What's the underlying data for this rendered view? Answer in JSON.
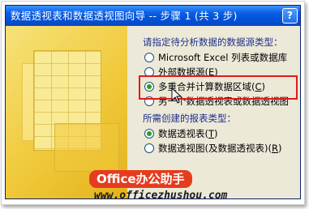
{
  "dialog": {
    "title": "数据透视表和数据透视图向导 -- 步骤 1 (共 3 步)",
    "help_label": "?"
  },
  "source_group": {
    "label": "请指定待分析数据的数据源类型：",
    "options": [
      {
        "pre": "Microsoft Excel 列表或数据库",
        "key": "",
        "post": "",
        "checked": false
      },
      {
        "pre": "外部数据源(",
        "key": "E",
        "post": ")",
        "checked": false
      },
      {
        "pre": "多重合并计算数据区域(",
        "key": "C",
        "post": ")",
        "checked": true
      },
      {
        "pre": "另一个数据透视表或数据透视图",
        "key": "",
        "post": "",
        "checked": false
      }
    ]
  },
  "report_group": {
    "label": "所需创建的报表类型：",
    "options": [
      {
        "pre": "数据透视表(",
        "key": "T",
        "post": ")",
        "checked": true
      },
      {
        "pre": "数据透视图(及数据透视表)(",
        "key": "R",
        "post": ")",
        "checked": false
      }
    ]
  },
  "watermark": {
    "badge": "Office办公助手",
    "url": "www.officezhushou.com"
  },
  "colors": {
    "highlight": "#e11a1a",
    "title_bar": "#0a5fe6",
    "dialog_bg": "#ece9d8",
    "radio_dot": "#21a121"
  }
}
